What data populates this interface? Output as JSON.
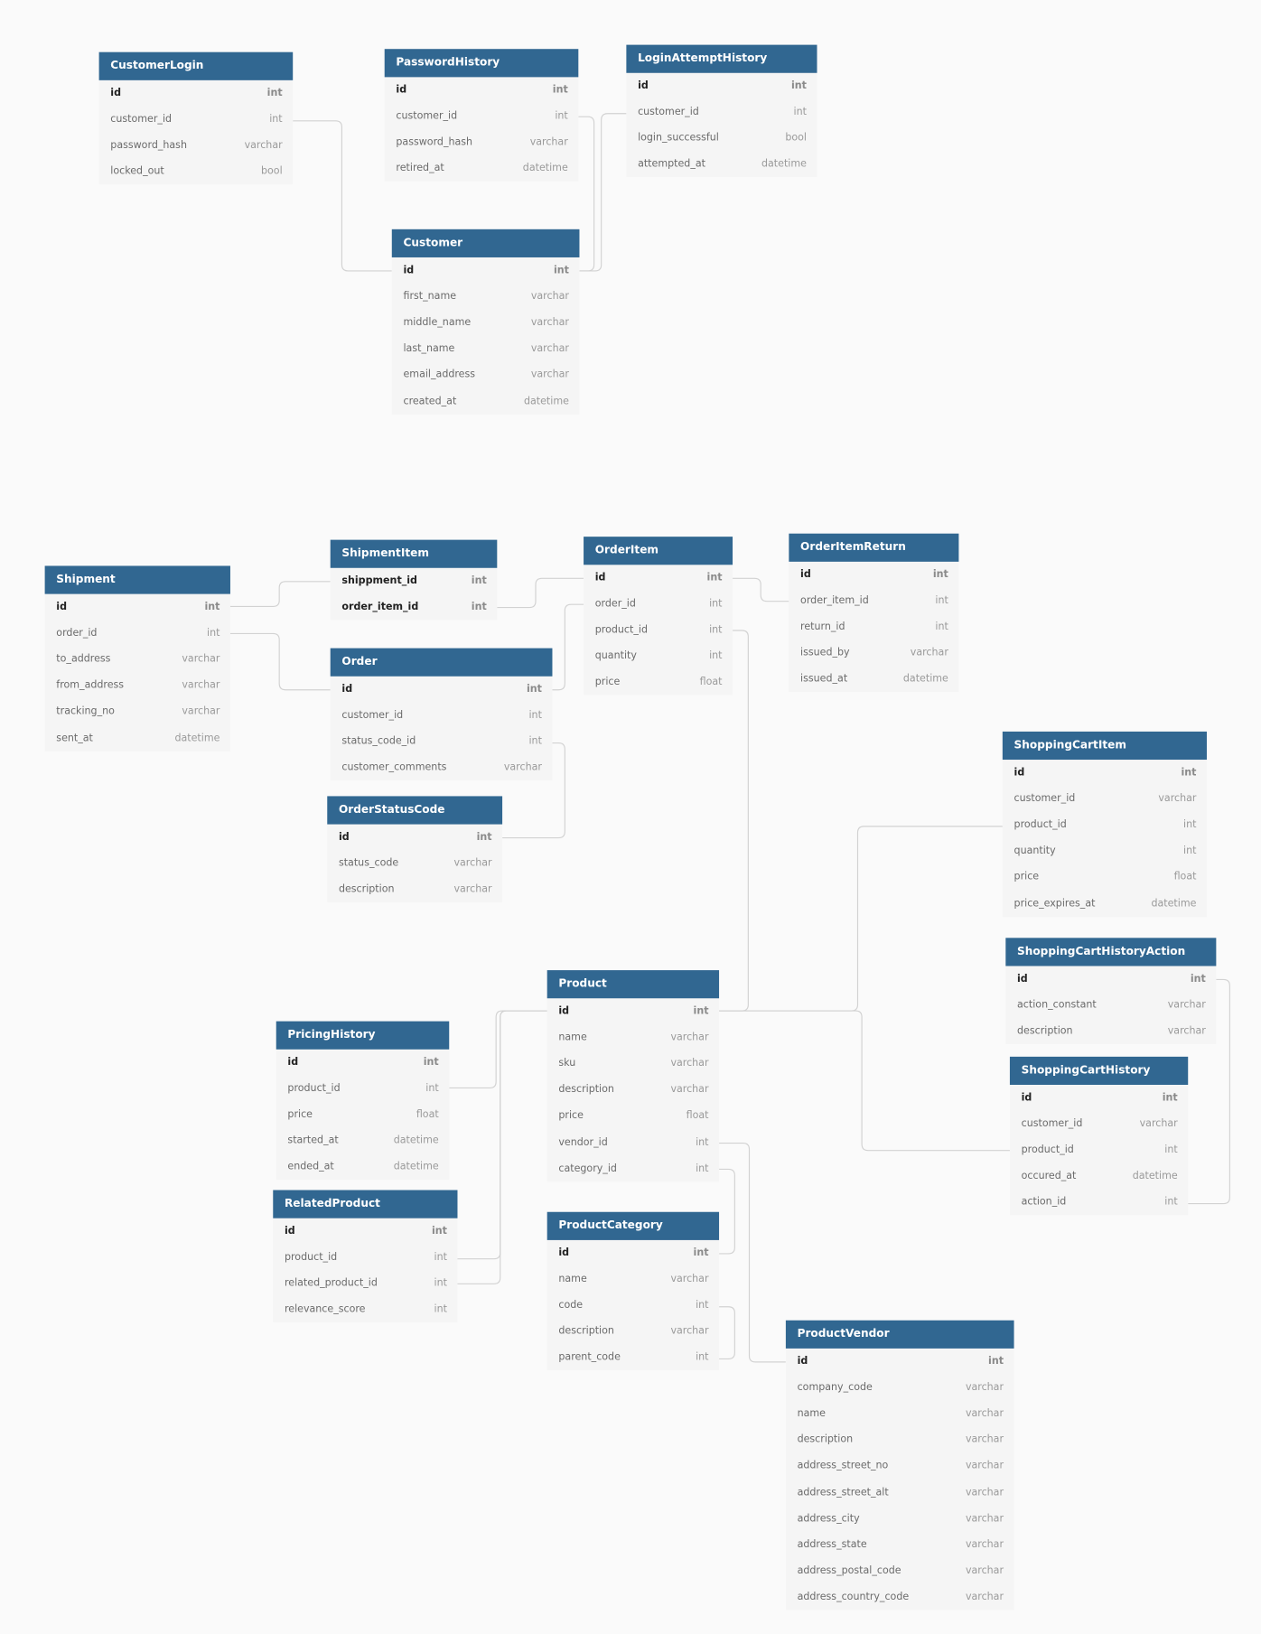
{
  "colors": {
    "header": "#316791",
    "body": "#f5f5f5",
    "background": "#fafafa",
    "connector": "#d2d2d2"
  },
  "tables": [
    {
      "name": "CustomerLogin",
      "columns": [
        {
          "name": "id",
          "type": "int",
          "pk": true
        },
        {
          "name": "customer_id",
          "type": "int"
        },
        {
          "name": "password_hash",
          "type": "varchar"
        },
        {
          "name": "locked_out",
          "type": "bool"
        }
      ]
    },
    {
      "name": "PasswordHistory",
      "columns": [
        {
          "name": "id",
          "type": "int",
          "pk": true
        },
        {
          "name": "customer_id",
          "type": "int"
        },
        {
          "name": "password_hash",
          "type": "varchar"
        },
        {
          "name": "retired_at",
          "type": "datetime"
        }
      ]
    },
    {
      "name": "LoginAttemptHistory",
      "columns": [
        {
          "name": "id",
          "type": "int",
          "pk": true
        },
        {
          "name": "customer_id",
          "type": "int"
        },
        {
          "name": "login_successful",
          "type": "bool"
        },
        {
          "name": "attempted_at",
          "type": "datetime"
        }
      ]
    },
    {
      "name": "Customer",
      "columns": [
        {
          "name": "id",
          "type": "int",
          "pk": true
        },
        {
          "name": "first_name",
          "type": "varchar"
        },
        {
          "name": "middle_name",
          "type": "varchar"
        },
        {
          "name": "last_name",
          "type": "varchar"
        },
        {
          "name": "email_address",
          "type": "varchar"
        },
        {
          "name": "created_at",
          "type": "datetime"
        }
      ]
    },
    {
      "name": "Shipment",
      "columns": [
        {
          "name": "id",
          "type": "int",
          "pk": true
        },
        {
          "name": "order_id",
          "type": "int"
        },
        {
          "name": "to_address",
          "type": "varchar"
        },
        {
          "name": "from_address",
          "type": "varchar"
        },
        {
          "name": "tracking_no",
          "type": "varchar"
        },
        {
          "name": "sent_at",
          "type": "datetime"
        }
      ]
    },
    {
      "name": "ShipmentItem",
      "columns": [
        {
          "name": "shippment_id",
          "type": "int",
          "pk": true
        },
        {
          "name": "order_item_id",
          "type": "int",
          "pk": true
        }
      ]
    },
    {
      "name": "OrderItem",
      "columns": [
        {
          "name": "id",
          "type": "int",
          "pk": true
        },
        {
          "name": "order_id",
          "type": "int"
        },
        {
          "name": "product_id",
          "type": "int"
        },
        {
          "name": "quantity",
          "type": "int"
        },
        {
          "name": "price",
          "type": "float"
        }
      ]
    },
    {
      "name": "OrderItemReturn",
      "columns": [
        {
          "name": "id",
          "type": "int",
          "pk": true
        },
        {
          "name": "order_item_id",
          "type": "int"
        },
        {
          "name": "return_id",
          "type": "int"
        },
        {
          "name": "issued_by",
          "type": "varchar"
        },
        {
          "name": "issued_at",
          "type": "datetime"
        }
      ]
    },
    {
      "name": "Order",
      "columns": [
        {
          "name": "id",
          "type": "int",
          "pk": true
        },
        {
          "name": "customer_id",
          "type": "int"
        },
        {
          "name": "status_code_id",
          "type": "int"
        },
        {
          "name": "customer_comments",
          "type": "varchar"
        }
      ]
    },
    {
      "name": "OrderStatusCode",
      "columns": [
        {
          "name": "id",
          "type": "int",
          "pk": true
        },
        {
          "name": "status_code",
          "type": "varchar"
        },
        {
          "name": "description",
          "type": "varchar"
        }
      ]
    },
    {
      "name": "ShoppingCartItem",
      "columns": [
        {
          "name": "id",
          "type": "int",
          "pk": true
        },
        {
          "name": "customer_id",
          "type": "varchar"
        },
        {
          "name": "product_id",
          "type": "int"
        },
        {
          "name": "quantity",
          "type": "int"
        },
        {
          "name": "price",
          "type": "float"
        },
        {
          "name": "price_expires_at",
          "type": "datetime"
        }
      ]
    },
    {
      "name": "ShoppingCartHistoryAction",
      "columns": [
        {
          "name": "id",
          "type": "int",
          "pk": true
        },
        {
          "name": "action_constant",
          "type": "varchar"
        },
        {
          "name": "description",
          "type": "varchar"
        }
      ]
    },
    {
      "name": "ShoppingCartHistory",
      "columns": [
        {
          "name": "id",
          "type": "int",
          "pk": true
        },
        {
          "name": "customer_id",
          "type": "varchar"
        },
        {
          "name": "product_id",
          "type": "int"
        },
        {
          "name": "occured_at",
          "type": "datetime"
        },
        {
          "name": "action_id",
          "type": "int"
        }
      ]
    },
    {
      "name": "Product",
      "columns": [
        {
          "name": "id",
          "type": "int",
          "pk": true
        },
        {
          "name": "name",
          "type": "varchar"
        },
        {
          "name": "sku",
          "type": "varchar"
        },
        {
          "name": "description",
          "type": "varchar"
        },
        {
          "name": "price",
          "type": "float"
        },
        {
          "name": "vendor_id",
          "type": "int"
        },
        {
          "name": "category_id",
          "type": "int"
        }
      ]
    },
    {
      "name": "PricingHistory",
      "columns": [
        {
          "name": "id",
          "type": "int",
          "pk": true
        },
        {
          "name": "product_id",
          "type": "int"
        },
        {
          "name": "price",
          "type": "float"
        },
        {
          "name": "started_at",
          "type": "datetime"
        },
        {
          "name": "ended_at",
          "type": "datetime"
        }
      ]
    },
    {
      "name": "RelatedProduct",
      "columns": [
        {
          "name": "id",
          "type": "int",
          "pk": true
        },
        {
          "name": "product_id",
          "type": "int"
        },
        {
          "name": "related_product_id",
          "type": "int"
        },
        {
          "name": "relevance_score",
          "type": "int"
        }
      ]
    },
    {
      "name": "ProductCategory",
      "columns": [
        {
          "name": "id",
          "type": "int",
          "pk": true
        },
        {
          "name": "name",
          "type": "varchar"
        },
        {
          "name": "code",
          "type": "int"
        },
        {
          "name": "description",
          "type": "varchar"
        },
        {
          "name": "parent_code",
          "type": "int"
        }
      ]
    },
    {
      "name": "ProductVendor",
      "columns": [
        {
          "name": "id",
          "type": "int",
          "pk": true
        },
        {
          "name": "company_code",
          "type": "varchar"
        },
        {
          "name": "name",
          "type": "varchar"
        },
        {
          "name": "description",
          "type": "varchar"
        },
        {
          "name": "address_street_no",
          "type": "varchar"
        },
        {
          "name": "address_street_alt",
          "type": "varchar"
        },
        {
          "name": "address_city",
          "type": "varchar"
        },
        {
          "name": "address_state",
          "type": "varchar"
        },
        {
          "name": "address_postal_code",
          "type": "varchar"
        },
        {
          "name": "address_country_code",
          "type": "varchar"
        }
      ]
    }
  ]
}
